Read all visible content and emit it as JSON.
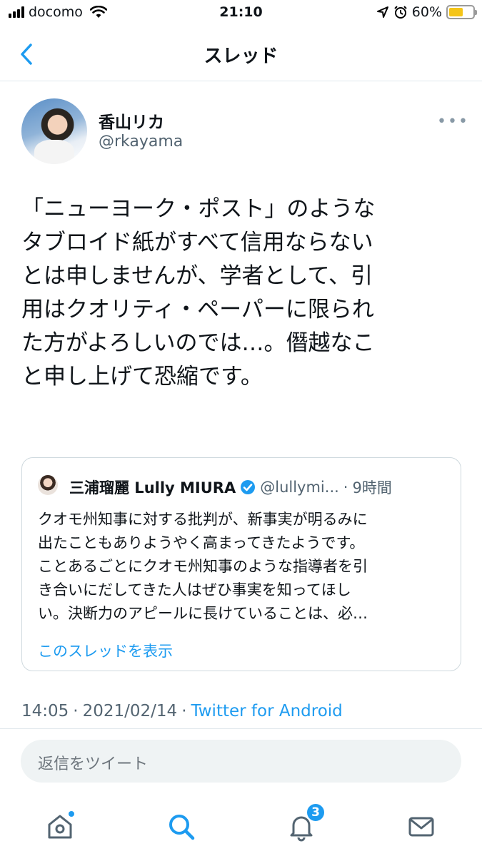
{
  "status_bar": {
    "carrier": "docomo",
    "time": "21:10",
    "battery": "60%",
    "battery_level": 0.6
  },
  "header": {
    "title": "スレッド",
    "back_icon": "chevron-left-icon"
  },
  "tweet": {
    "author_name": "香山リカ",
    "author_handle": "@rkayama",
    "text": "「ニューヨーク・ポスト」のような\nタブロイド紙がすべて信用ならない\nとは申しませんが、学者として、引\n用はクオリティ・ペーパーに限られ\nた方がよろしいのでは…。僭越なこ\nと申し上げて恐縮です。",
    "time": "14:05",
    "separator": "·",
    "date": "2021/02/14",
    "client": "Twitter for Android"
  },
  "quoted_tweet": {
    "author_name": "三浦瑠麗 Lully MIURA",
    "author_handle": "@lullymi...",
    "separator": "·",
    "time": "9時間",
    "text": "クオモ州知事に対する批判が、新事実が明るみに\n出たこともありようやく高まってきたようです。\nことあるごとにクオモ州知事のような指導者を引\nき合いにだしてきた人はぜひ事実を知ってほし\nい。決断力のアピールに長けていることは、必…",
    "show_thread": "このスレッドを表示"
  },
  "reply": {
    "placeholder": "返信をツイート"
  },
  "tab_bar": {
    "items": [
      "home-icon",
      "search-icon",
      "notifications-icon",
      "messages-icon"
    ],
    "notification_count": "3",
    "accent": "#1d9bf0"
  }
}
